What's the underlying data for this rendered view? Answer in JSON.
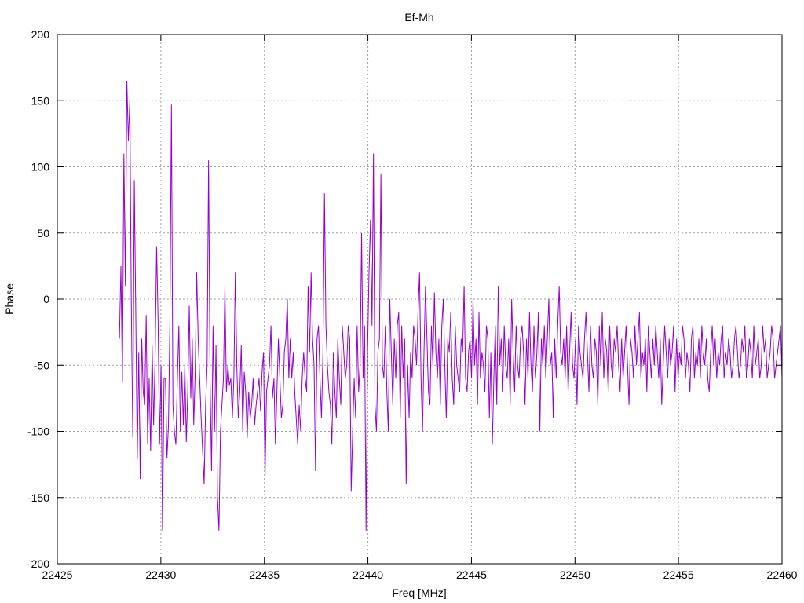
{
  "chart_data": {
    "type": "line",
    "title": "Ef-Mh",
    "xlabel": "Freq [MHz]",
    "ylabel": "Phase",
    "xlim": [
      22425,
      22460
    ],
    "ylim": [
      -200,
      200
    ],
    "xticks": [
      22425,
      22430,
      22435,
      22440,
      22445,
      22450,
      22455,
      22460
    ],
    "yticks": [
      -200,
      -150,
      -100,
      -50,
      0,
      50,
      100,
      150,
      200
    ],
    "grid": true,
    "colors": {
      "series": "#9400d3"
    },
    "series": [
      {
        "x_start": 22428,
        "x_end": 22460,
        "y": [
          -30,
          25,
          -63,
          110,
          10,
          165,
          120,
          150,
          -5,
          -104,
          90,
          -10,
          -121,
          -40,
          -136,
          -30,
          -70,
          -80,
          -12,
          -110,
          -60,
          -115,
          -35,
          -95,
          -45,
          40,
          -15,
          -110,
          -50,
          -175,
          -60,
          -60,
          -120,
          -95,
          -15,
          147,
          -80,
          -100,
          -110,
          -60,
          -20,
          -100,
          -55,
          -95,
          -50,
          -108,
          -70,
          -5,
          -75,
          -30,
          -95,
          -55,
          20,
          -30,
          -60,
          -90,
          -115,
          -140,
          -80,
          -50,
          105,
          -60,
          -130,
          -20,
          -100,
          -35,
          -150,
          -175,
          -100,
          -80,
          -60,
          10,
          -70,
          -50,
          -65,
          -60,
          -90,
          -60,
          20,
          -50,
          -90,
          -70,
          -35,
          -100,
          -55,
          -70,
          -105,
          -70,
          -90,
          -80,
          -60,
          -95,
          -80,
          -70,
          -60,
          -85,
          -55,
          -40,
          -135,
          -70,
          -60,
          -50,
          -20,
          -75,
          -60,
          -110,
          -70,
          -30,
          -60,
          -90,
          -80,
          -40,
          -30,
          0,
          -60,
          -30,
          -60,
          -40,
          -70,
          -90,
          -110,
          -80,
          -100,
          -60,
          -40,
          -60,
          -70,
          10,
          -40,
          20,
          -30,
          -50,
          -130,
          -30,
          -20,
          -60,
          -90,
          -40,
          80,
          -20,
          -50,
          -70,
          -80,
          -110,
          -40,
          -70,
          -90,
          -30,
          -60,
          -80,
          -20,
          -40,
          -60,
          -50,
          -20,
          -30,
          -145,
          -100,
          -60,
          -90,
          -20,
          -70,
          -50,
          50,
          -60,
          -20,
          -175,
          -40,
          20,
          60,
          -20,
          110,
          -80,
          -100,
          -40,
          -30,
          95,
          -50,
          -60,
          -20,
          -70,
          -100,
          0,
          -40,
          -80,
          -30,
          -60,
          -20,
          -10,
          -90,
          -20,
          -60,
          -30,
          -140,
          -50,
          -90,
          -40,
          -60,
          -20,
          -30,
          -50,
          -10,
          20,
          -60,
          -100,
          -40,
          10,
          -30,
          -70,
          -80,
          -20,
          -50,
          5,
          -40,
          -60,
          -30,
          -80,
          -20,
          0,
          -50,
          -90,
          -30,
          -40,
          -10,
          -60,
          -80,
          -20,
          -50,
          -60,
          -70,
          -30,
          -40,
          10,
          -60,
          -70,
          -40,
          -30,
          -60,
          0,
          -50,
          -30,
          -80,
          -10,
          -60,
          -40,
          -50,
          -70,
          -20,
          -30,
          -90,
          -40,
          -110,
          -60,
          -20,
          -80,
          10,
          -50,
          -30,
          -70,
          -20,
          -50,
          -60,
          -30,
          -80,
          0,
          -40,
          -70,
          -20,
          -50,
          -60,
          -30,
          -20,
          -40,
          -80,
          -30,
          -60,
          -10,
          -50,
          -70,
          -20,
          -60,
          -40,
          -10,
          -100,
          -30,
          -50,
          -20,
          -60,
          -30,
          0,
          -50,
          -40,
          -90,
          -30,
          -60,
          -20,
          10,
          -40,
          -50,
          -30,
          -60,
          -20,
          -70,
          -40,
          -10,
          -50,
          -60,
          -30,
          -80,
          -20,
          -40,
          -50,
          -60,
          -30,
          -10,
          -40,
          -70,
          -20,
          -50,
          -60,
          -30,
          -40,
          -80,
          -20,
          -50,
          -10,
          -60,
          -30,
          -40,
          -70,
          -20,
          -50,
          -60,
          -30,
          -40,
          -20,
          -50,
          -70,
          -30,
          -60,
          -40,
          -20,
          -50,
          -80,
          -30,
          -40,
          -60,
          -20,
          -50,
          -30,
          -10,
          -60,
          -40,
          -50,
          -30,
          -70,
          -20,
          -40,
          -60,
          -30,
          -50,
          -20,
          -40,
          -60,
          -30,
          -80,
          -50,
          -20,
          -40,
          -60,
          -30,
          -50,
          -40,
          -20,
          -70,
          -30,
          -60,
          -40,
          -50,
          -20,
          -30,
          -60,
          -40,
          -50,
          -70,
          -30,
          -20,
          -60,
          -40,
          -50,
          -30,
          -60,
          -20,
          -40,
          -50,
          -30,
          -60,
          -70,
          -40,
          -20,
          -50,
          -30,
          -60,
          -40,
          -50,
          -30,
          -20,
          -60,
          -40,
          -50,
          -30,
          -40,
          -60,
          -50,
          -30,
          -20,
          -40,
          -60,
          -50,
          -30,
          -40,
          -20,
          -60,
          -50,
          -30,
          -40,
          -60,
          -20,
          -50,
          -40,
          -30,
          -60,
          -50,
          -20,
          -40,
          -30,
          -60,
          -50,
          -40,
          -20,
          -30,
          -60,
          -50,
          -40,
          -30,
          -20,
          -60
        ]
      }
    ]
  }
}
